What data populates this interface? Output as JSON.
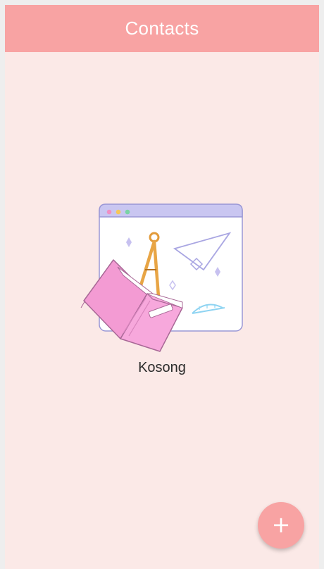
{
  "app_bar": {
    "title": "Contacts"
  },
  "empty_state": {
    "label": "Kosong",
    "illustration_icon": "empty-state-illustration"
  },
  "fab": {
    "icon": "plus-icon",
    "glyph": "+"
  },
  "colors": {
    "primary": "#f8a3a3",
    "background": "#fbe9e7"
  }
}
